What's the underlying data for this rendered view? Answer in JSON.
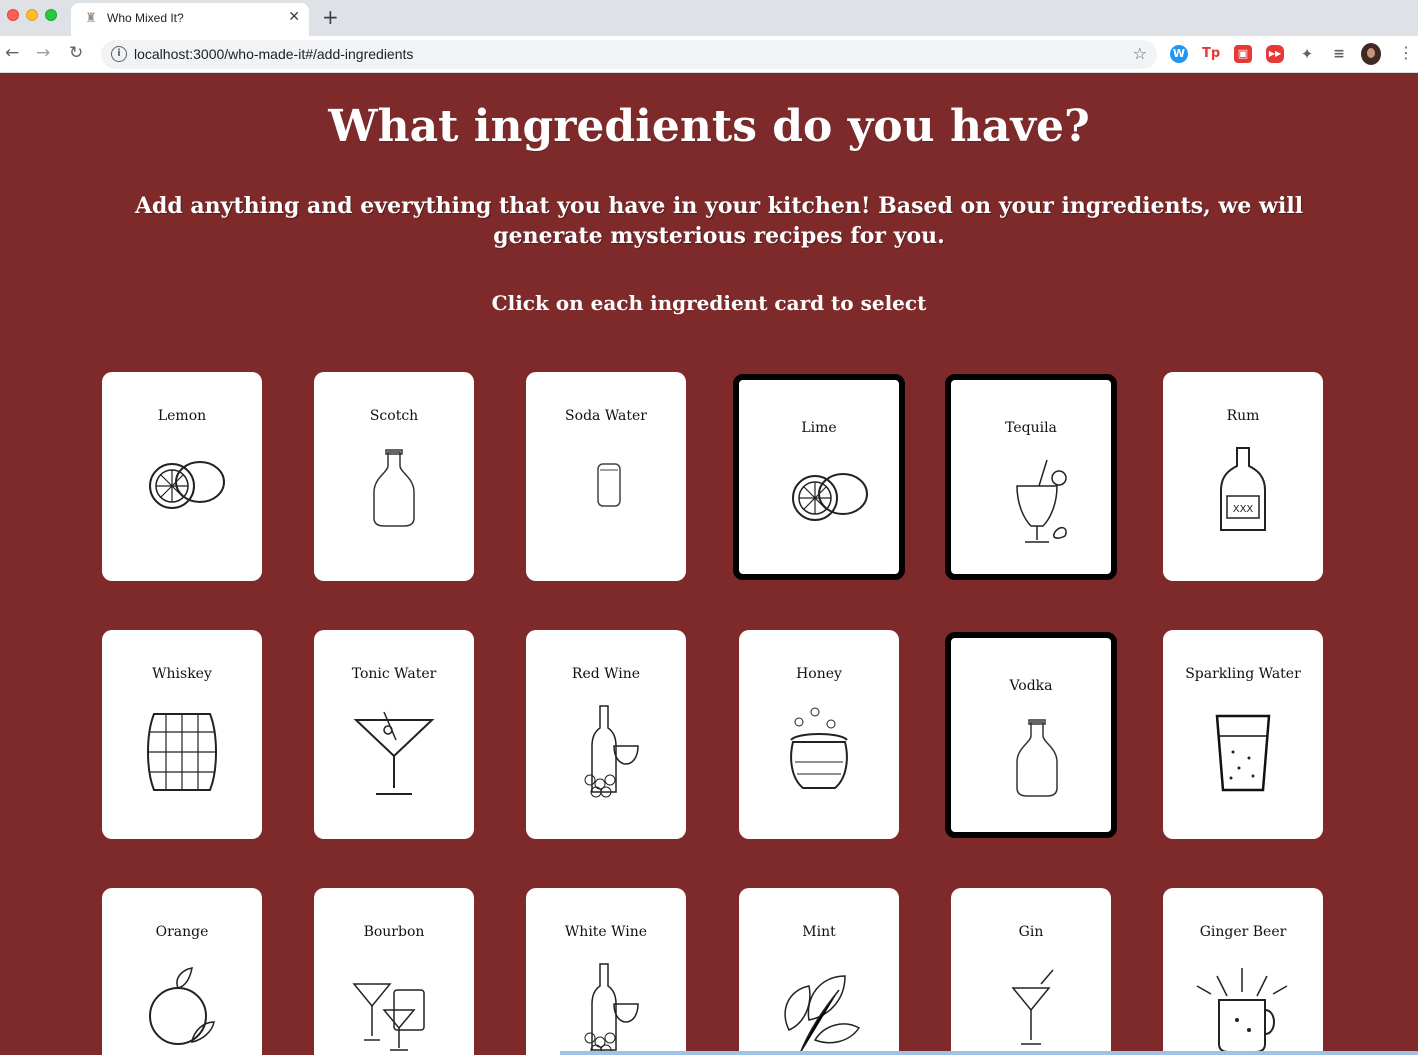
{
  "browser": {
    "tab_title": "Who Mixed It?",
    "url": "localhost:3000/who-made-it#/add-ingredients",
    "new_tab_symbol": "+",
    "close_symbol": "✕",
    "extensions": [
      "W",
      "Tp",
      "▣",
      "▶▶",
      "✦",
      "≡"
    ]
  },
  "page": {
    "title": "What ingredients do you have?",
    "subtitle": "Add anything and everything that you have in your kitchen! Based on your ingredients, we will generate mysterious recipes for you.",
    "instruction": "Click on each ingredient card to select"
  },
  "ingredients": [
    {
      "name": "Lemon",
      "icon": "citrus-icon",
      "selected": false
    },
    {
      "name": "Scotch",
      "icon": "bottle-icon",
      "selected": false
    },
    {
      "name": "Soda Water",
      "icon": "can-icon",
      "selected": false
    },
    {
      "name": "Lime",
      "icon": "citrus-icon",
      "selected": true
    },
    {
      "name": "Tequila",
      "icon": "tropical-cocktail-icon",
      "selected": true
    },
    {
      "name": "Rum",
      "icon": "rum-bottle-icon",
      "selected": false
    },
    {
      "name": "Whiskey",
      "icon": "barrel-icon",
      "selected": false
    },
    {
      "name": "Tonic Water",
      "icon": "martini-icon",
      "selected": false
    },
    {
      "name": "Red Wine",
      "icon": "wine-bottle-icon",
      "selected": false
    },
    {
      "name": "Honey",
      "icon": "honey-pot-icon",
      "selected": false
    },
    {
      "name": "Vodka",
      "icon": "bottle-icon",
      "selected": true
    },
    {
      "name": "Sparkling Water",
      "icon": "glass-icon",
      "selected": false
    },
    {
      "name": "Orange",
      "icon": "orange-icon",
      "selected": false
    },
    {
      "name": "Bourbon",
      "icon": "cocktail-glasses-icon",
      "selected": false
    },
    {
      "name": "White Wine",
      "icon": "wine-bottle-icon",
      "selected": false
    },
    {
      "name": "Mint",
      "icon": "mint-leaf-icon",
      "selected": false
    },
    {
      "name": "Gin",
      "icon": "cocktail-icon",
      "selected": false
    },
    {
      "name": "Ginger Beer",
      "icon": "mug-icon",
      "selected": false
    }
  ]
}
